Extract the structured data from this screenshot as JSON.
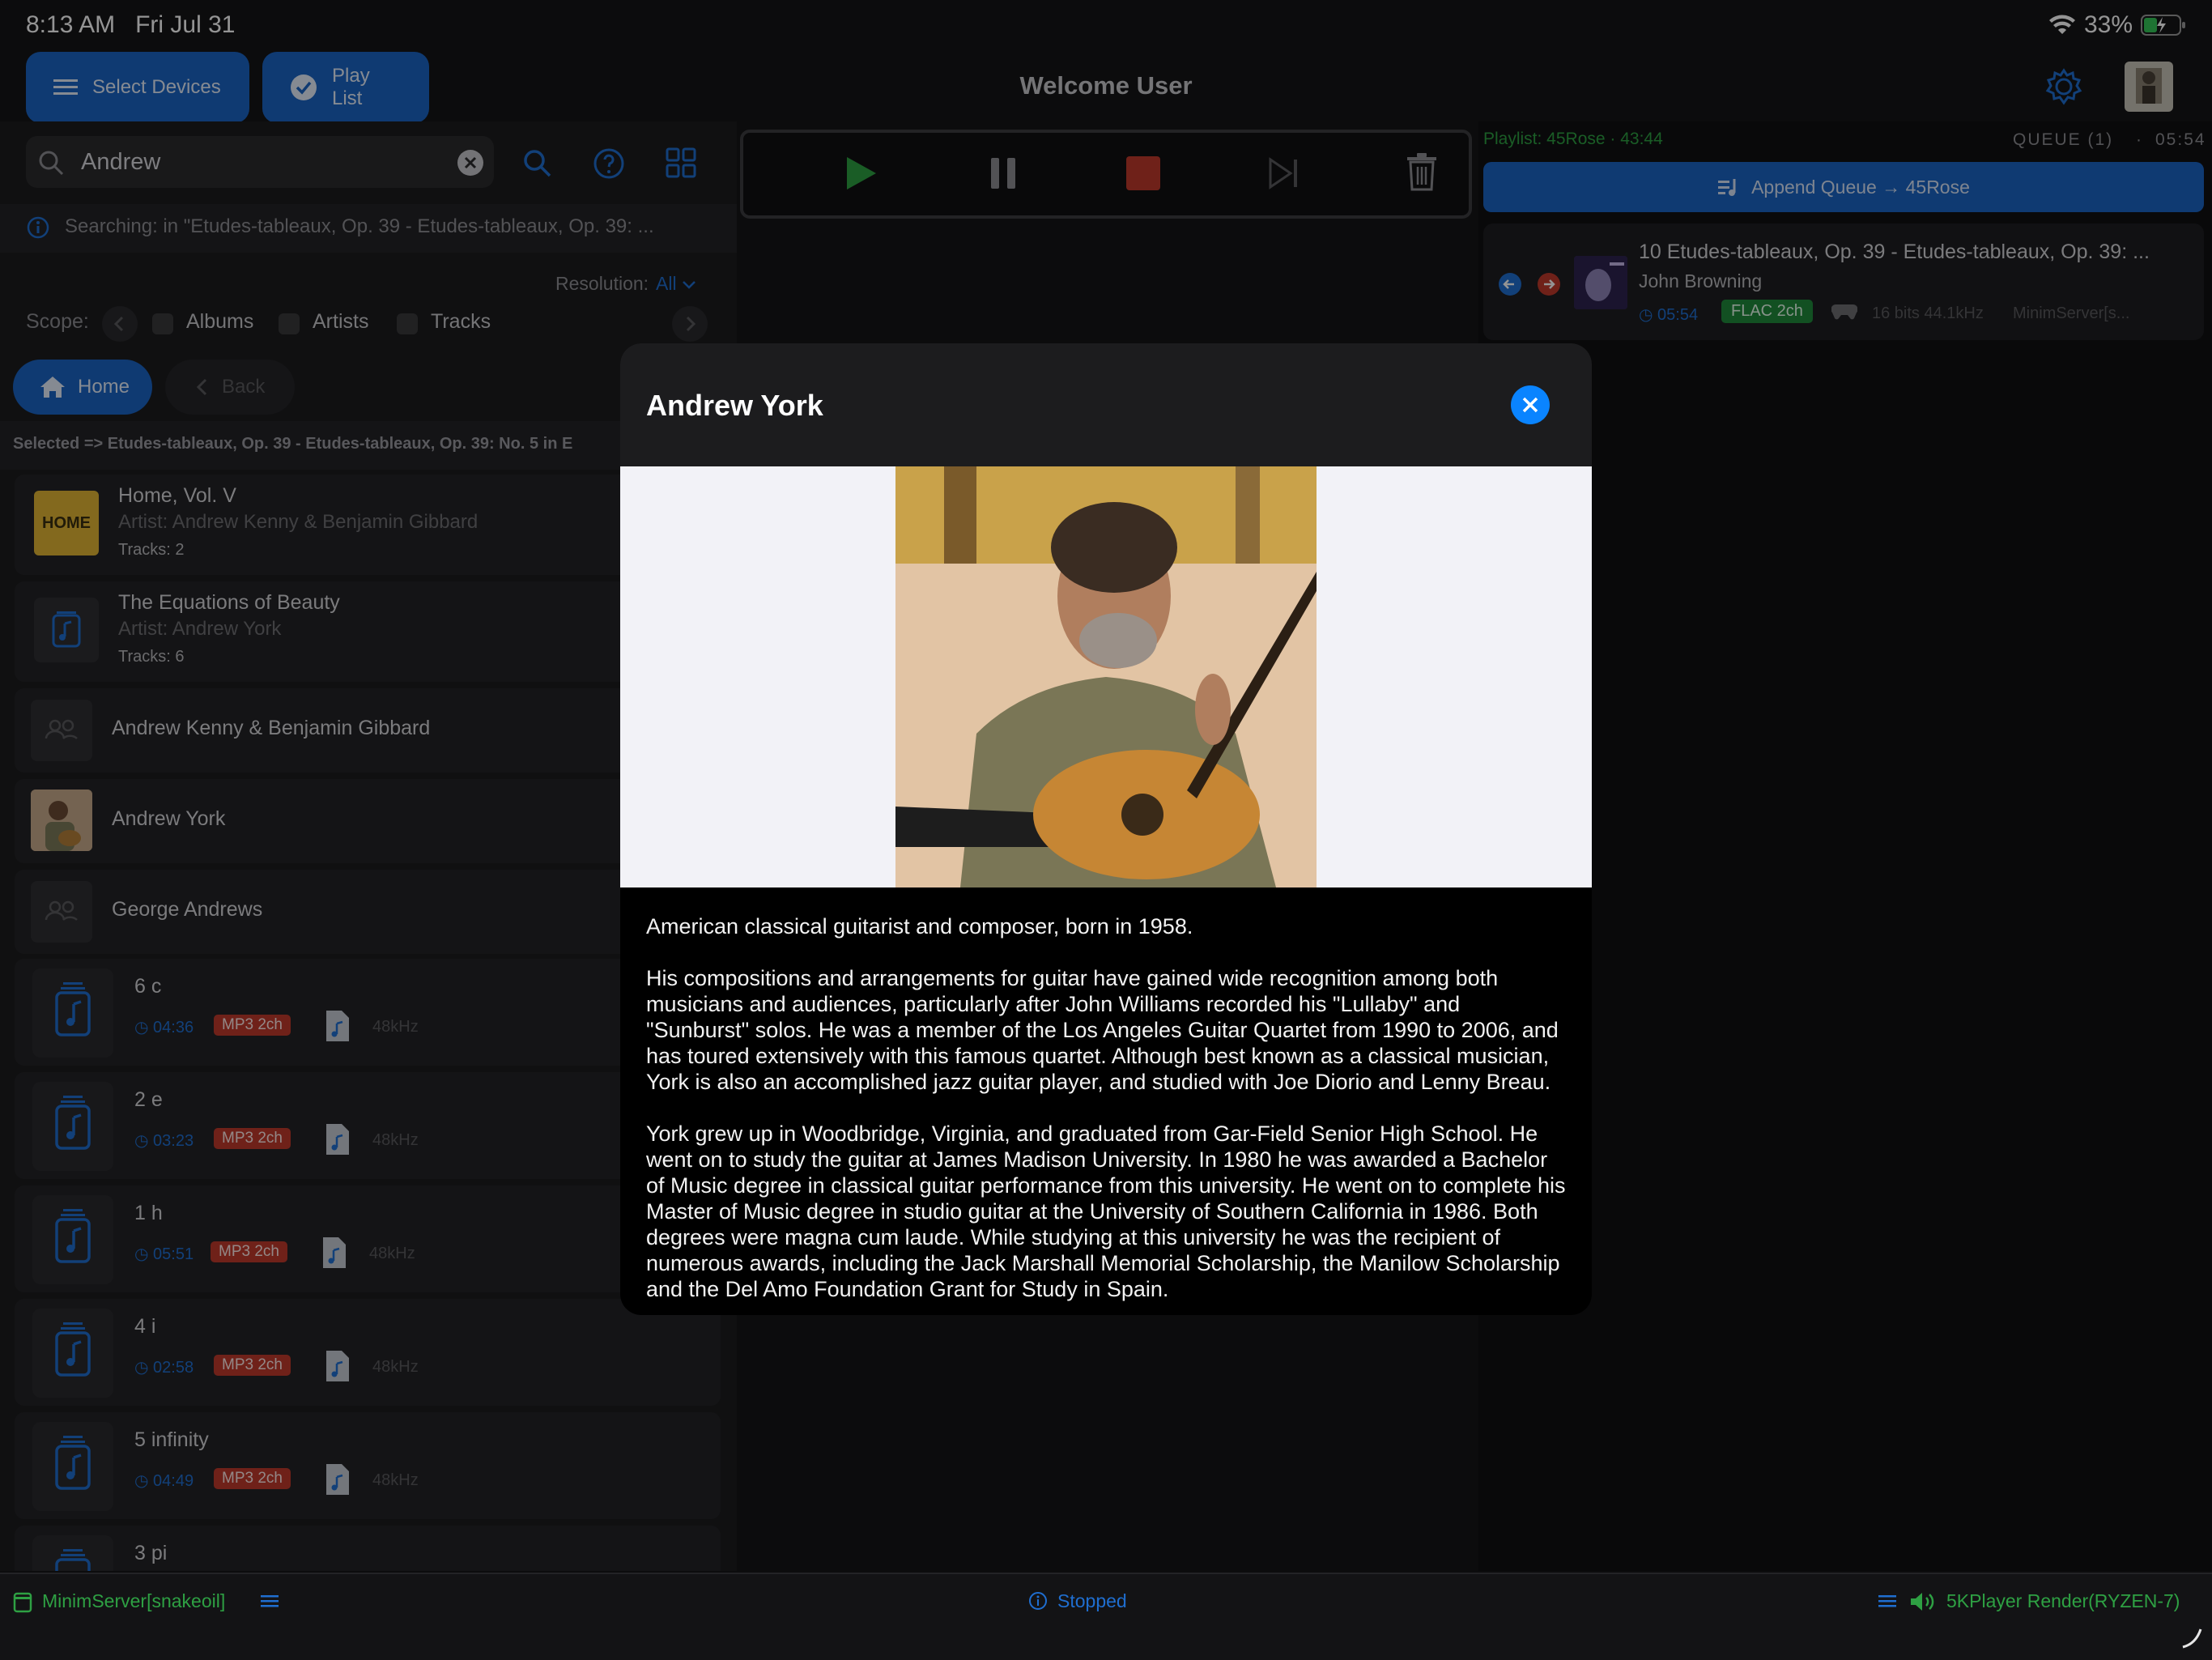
{
  "status_bar": {
    "time": "8:13 AM",
    "date": "Fri Jul 31",
    "battery": "33%"
  },
  "header": {
    "select_devices": "Select Devices",
    "play_list": "Play List",
    "welcome": "Welcome User"
  },
  "search": {
    "value": "Andrew",
    "info": "Searching: in \"Etudes-tableaux, Op. 39 - Etudes-tableaux, Op. 39: ...",
    "resolution_label": "Resolution:",
    "resolution_value": "All",
    "scope_label": "Scope:",
    "scope_albums": "Albums",
    "scope_artists": "Artists",
    "scope_tracks": "Tracks",
    "home": "Home",
    "back": "Back",
    "selected": "Selected => Etudes-tableaux, Op. 39 - Etudes-tableaux, Op. 39: No. 5 in E"
  },
  "results": {
    "albums": [
      {
        "title": "Home, Vol. V",
        "artist": "Artist: Andrew Kenny & Benjamin Gibbard",
        "tracks": "Tracks: 2",
        "thumb_text": "HOME"
      },
      {
        "title": "The Equations of Beauty",
        "artist": "Artist: Andrew York",
        "tracks": "Tracks: 6"
      }
    ],
    "artists": [
      {
        "name": "Andrew Kenny & Benjamin Gibbard"
      },
      {
        "name": "Andrew York"
      },
      {
        "name": "George Andrews"
      }
    ],
    "tracks": [
      {
        "title": "6 c",
        "time": "04:36",
        "format": "MP3 2ch",
        "rate": "48kHz"
      },
      {
        "title": "2 e",
        "time": "03:23",
        "format": "MP3 2ch",
        "rate": "48kHz"
      },
      {
        "title": "1 h",
        "time": "05:51",
        "format": "MP3 2ch",
        "rate": "48kHz"
      },
      {
        "title": "4 i",
        "time": "02:58",
        "format": "MP3 2ch",
        "rate": "48kHz"
      },
      {
        "title": "5 infinity",
        "time": "04:49",
        "format": "MP3 2ch",
        "rate": "48kHz"
      },
      {
        "title": "3 pi"
      }
    ]
  },
  "queue": {
    "playlist": "Playlist: 45Rose · 43:44",
    "queue_label": "QUEUE (1)",
    "queue_time": "05:54",
    "append": "Append Queue → 45Rose",
    "item": {
      "title": "10 Etudes-tableaux, Op. 39 - Etudes-tableaux, Op. 39: ...",
      "artist": "John Browning",
      "time": "05:54",
      "format": "FLAC 2ch",
      "bits": "16 bits 44.1kHz",
      "server": "MinimServer[s..."
    }
  },
  "modal": {
    "title": "Andrew York",
    "bio": [
      "American classical guitarist and composer, born in 1958.",
      "His compositions and arrangements for guitar have gained wide recognition among both musicians and audiences, particularly after John Williams recorded his \"Lullaby\" and \"Sunburst\" solos. He was a member of the Los Angeles Guitar Quartet from 1990 to 2006, and has toured extensively with this famous quartet. Although best known as a classical musician, York is also an accomplished jazz guitar player, and studied with Joe Diorio and Lenny Breau.",
      "York grew up in Woodbridge, Virginia, and graduated from Gar-Field Senior High School. He went on to study the guitar at James Madison University. In 1980 he was awarded a Bachelor of Music degree in classical guitar performance from this university. He went on to complete his Master of Music degree in studio guitar at the University of Southern California in 1986. Both degrees were magna cum laude. While studying at this university he was the recipient of numerous awards, including the Jack Marshall Memorial Scholarship, the Manilow Scholarship and the Del Amo Foundation Grant for Study in Spain."
    ]
  },
  "bottom_bar": {
    "server": "MinimServer[snakeoil]",
    "status": "Stopped",
    "renderer": "5KPlayer Render(RYZEN-7)"
  },
  "colors": {
    "accent": "#1a64c4",
    "play": "#2ea043",
    "stop": "#c0392b",
    "status_green": "#2ea043",
    "badge_red": "#c0392b"
  }
}
